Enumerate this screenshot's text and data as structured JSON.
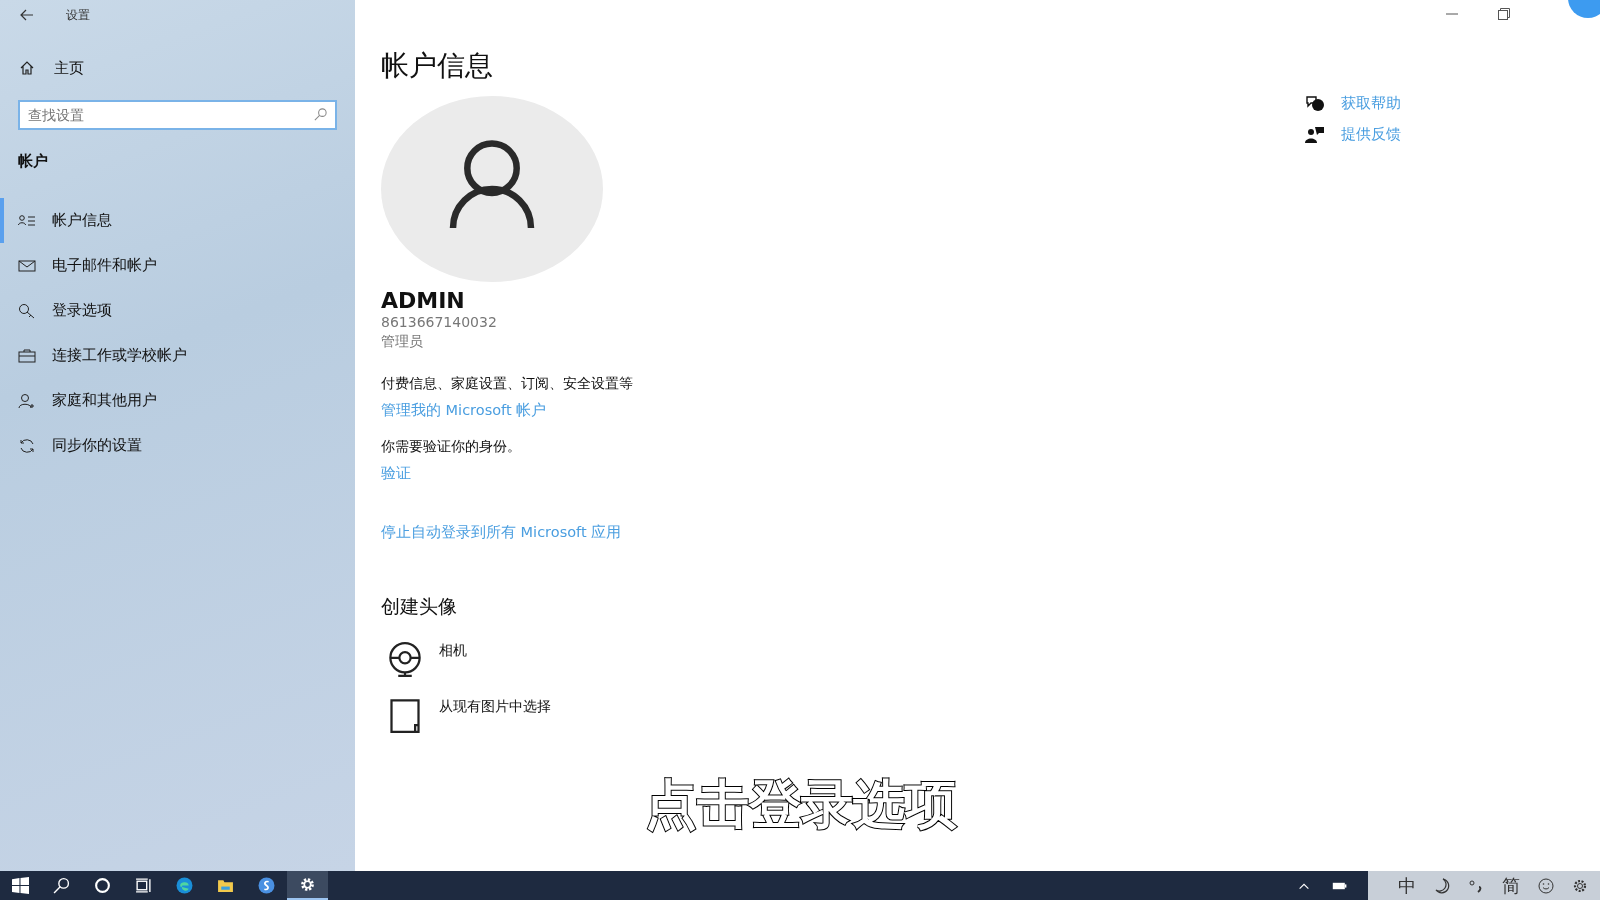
{
  "window": {
    "title": "设置"
  },
  "sidebar": {
    "home": "主页",
    "search": {
      "placeholder": "查找设置"
    },
    "section": "帐户",
    "items": [
      {
        "label": "帐户信息",
        "kind": "account",
        "selected": true
      },
      {
        "label": "电子邮件和帐户",
        "kind": "mail",
        "selected": false
      },
      {
        "label": "登录选项",
        "kind": "key",
        "selected": false
      },
      {
        "label": "连接工作或学校帐户",
        "kind": "briefcase",
        "selected": false
      },
      {
        "label": "家庭和其他用户",
        "kind": "person",
        "selected": false
      },
      {
        "label": "同步你的设置",
        "kind": "sync",
        "selected": false
      }
    ]
  },
  "main": {
    "title": "帐户信息",
    "user": {
      "name": "ADMIN",
      "id": "8613667140032",
      "role": "管理员"
    },
    "billing_text": "付费信息、家庭设置、订阅、安全设置等",
    "manage_link": "管理我的 Microsoft 帐户",
    "verify_text": "你需要验证你的身份。",
    "verify_link": "验证",
    "stop_link": "停止自动登录到所有 Microsoft 应用",
    "avatar_heading": "创建头像",
    "avatar_options": [
      {
        "label": "相机",
        "kind": "camera"
      },
      {
        "label": "从现有图片中选择",
        "kind": "file"
      }
    ]
  },
  "help_links": [
    {
      "label": "获取帮助",
      "kind": "help"
    },
    {
      "label": "提供反馈",
      "kind": "feedback"
    }
  ],
  "caption": "点击登录选项",
  "taskbar": {
    "ime": [
      {
        "label": "中"
      },
      {
        "label": "简"
      }
    ]
  }
}
